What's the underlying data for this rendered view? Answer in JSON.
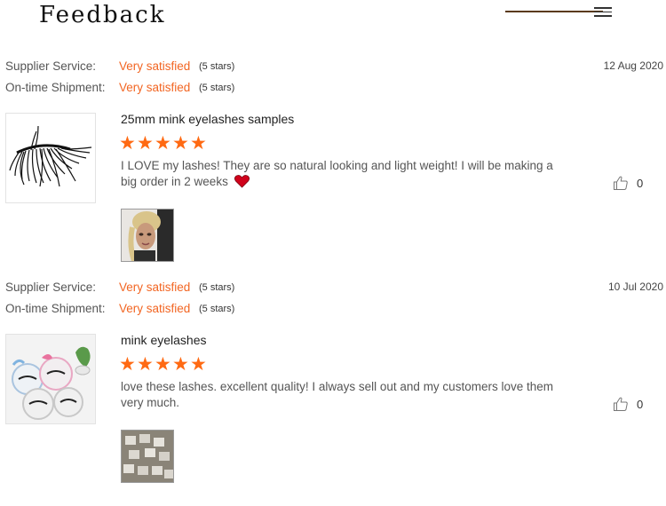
{
  "header": {
    "title": "Feedback",
    "menu_icon": "hamburger-menu-icon"
  },
  "reviews": [
    {
      "supplier_label": "Supplier Service:",
      "supplier_value": "Very satisfied",
      "supplier_stars": "(5 stars)",
      "shipment_label": "On-time Shipment:",
      "shipment_value": "Very satisfied",
      "shipment_stars": "(5 stars)",
      "date": "12 Aug 2020",
      "product_name": "25mm mink eyelashes samples",
      "rating": 5,
      "text": "I LOVE my lashes! They are so natural looking and light weight! I will be making a big order in 2 weeks",
      "emoji": "heart-icon",
      "likes": "0"
    },
    {
      "supplier_label": "Supplier Service:",
      "supplier_value": "Very satisfied",
      "supplier_stars": "(5 stars)",
      "shipment_label": "On-time Shipment:",
      "shipment_value": "Very satisfied",
      "shipment_stars": "(5 stars)",
      "date": "10 Jul 2020",
      "product_name": "mink eyelashes",
      "rating": 5,
      "text": "love these lashes. excellent quality! I always sell out and my customers love them very much.",
      "likes": "0"
    }
  ],
  "colors": {
    "accent": "#f26522",
    "star": "#ff6a13",
    "title_line": "#5a3a1a"
  }
}
